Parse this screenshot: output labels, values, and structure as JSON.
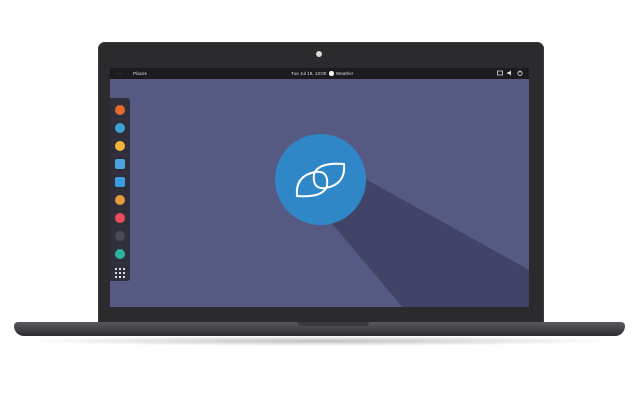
{
  "topbar": {
    "activities_icon": "dots-icon",
    "places_label": "Places",
    "clock": "Tue Jul 19, 13:00",
    "weather_label": "Weather",
    "tray_icons": [
      "network-icon",
      "volume-icon",
      "power-icon"
    ]
  },
  "dock": {
    "apps": [
      {
        "name": "firefox-icon",
        "color": "#e66a2c"
      },
      {
        "name": "mail-icon",
        "color": "#3aa1d8"
      },
      {
        "name": "music-icon",
        "color": "#f2b33a"
      },
      {
        "name": "files-icon",
        "color": "#4aa3df"
      },
      {
        "name": "documents-icon",
        "color": "#3d9be0"
      },
      {
        "name": "photos-icon",
        "color": "#e59a3b"
      },
      {
        "name": "software-icon",
        "color": "#e84c5a"
      },
      {
        "name": "terminal-icon",
        "color": "#4a4a52"
      },
      {
        "name": "settings-icon",
        "color": "#2bb4a0"
      }
    ],
    "show_apps_icon": "app-grid-icon"
  },
  "desktop": {
    "logo_icon": "endless-style-logo-icon",
    "logo_color": "#2f87c8",
    "wallpaper_color": "#565a82"
  }
}
